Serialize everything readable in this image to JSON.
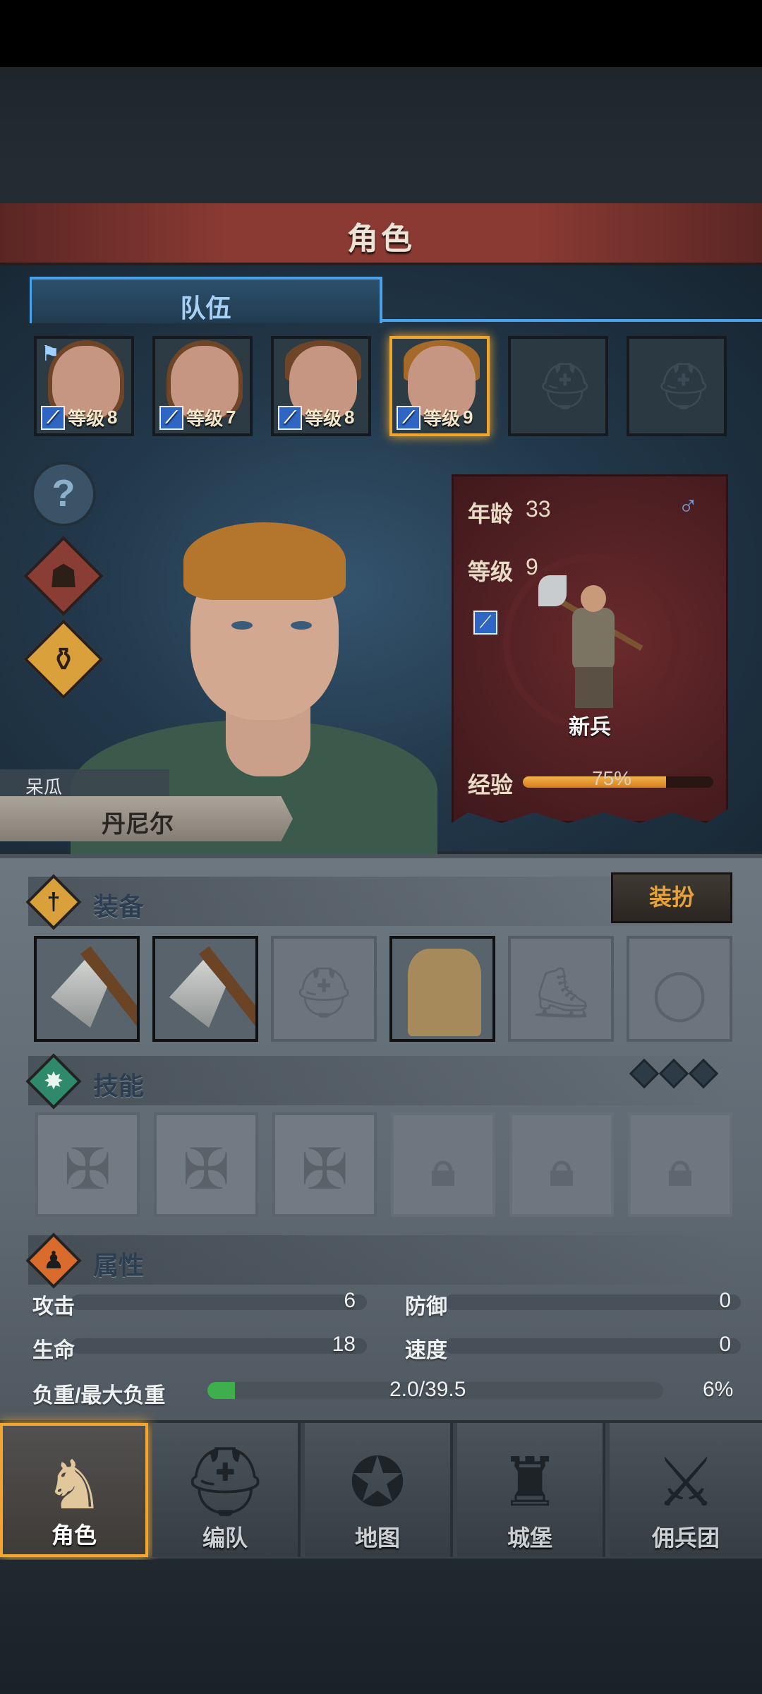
{
  "title": "角色",
  "tab": "队伍",
  "party": [
    {
      "level_label": "等级",
      "level": "8",
      "flag": true,
      "hair": "long",
      "empty": false,
      "selected": false
    },
    {
      "level_label": "等级",
      "level": "7",
      "flag": false,
      "hair": "long",
      "empty": false,
      "selected": false
    },
    {
      "level_label": "等级",
      "level": "8",
      "flag": false,
      "hair": "short",
      "empty": false,
      "selected": false
    },
    {
      "level_label": "等级",
      "level": "9",
      "flag": false,
      "hair": "short",
      "empty": false,
      "selected": true
    },
    {
      "empty": true
    },
    {
      "empty": true
    }
  ],
  "character": {
    "trait": "呆瓜",
    "name": "丹尼尔",
    "age_label": "年龄",
    "age": "33",
    "level_label": "等级",
    "level": "9",
    "gender_icon": "♂",
    "class": "新兵",
    "xp_label": "经验",
    "xp_text": "75%",
    "xp_fraction": 0.75
  },
  "sections": {
    "equipment": "装备",
    "skills": "技能",
    "attributes": "属性"
  },
  "outfit_button": "装扮",
  "equipment_slots": [
    "axe",
    "axe",
    "helmet-empty",
    "shirt",
    "boots-empty",
    "ring-empty"
  ],
  "skills_slots": [
    "cross",
    "cross",
    "cross",
    "locked",
    "locked",
    "locked"
  ],
  "attributes": {
    "attack_label": "攻击",
    "attack": "6",
    "defense_label": "防御",
    "defense": "0",
    "health_label": "生命",
    "health": "18",
    "speed_label": "速度",
    "speed": "0",
    "load_label": "负重/最大负重",
    "load": "2.0/39.5",
    "load_pct": "6%",
    "load_fraction": 0.06
  },
  "nav": [
    {
      "label": "角色",
      "icon": "knight-icon",
      "active": true
    },
    {
      "label": "编队",
      "icon": "helmet-icon",
      "active": false
    },
    {
      "label": "地图",
      "icon": "compass-icon",
      "active": false
    },
    {
      "label": "城堡",
      "icon": "castle-icon",
      "active": false
    },
    {
      "label": "佣兵团",
      "icon": "banner-icon",
      "active": false
    }
  ],
  "colors": {
    "accent": "#f2a62d",
    "tab_blue": "#4aa2ea",
    "banner_red": "#4e1f22",
    "title_red": "#8a3a33"
  }
}
